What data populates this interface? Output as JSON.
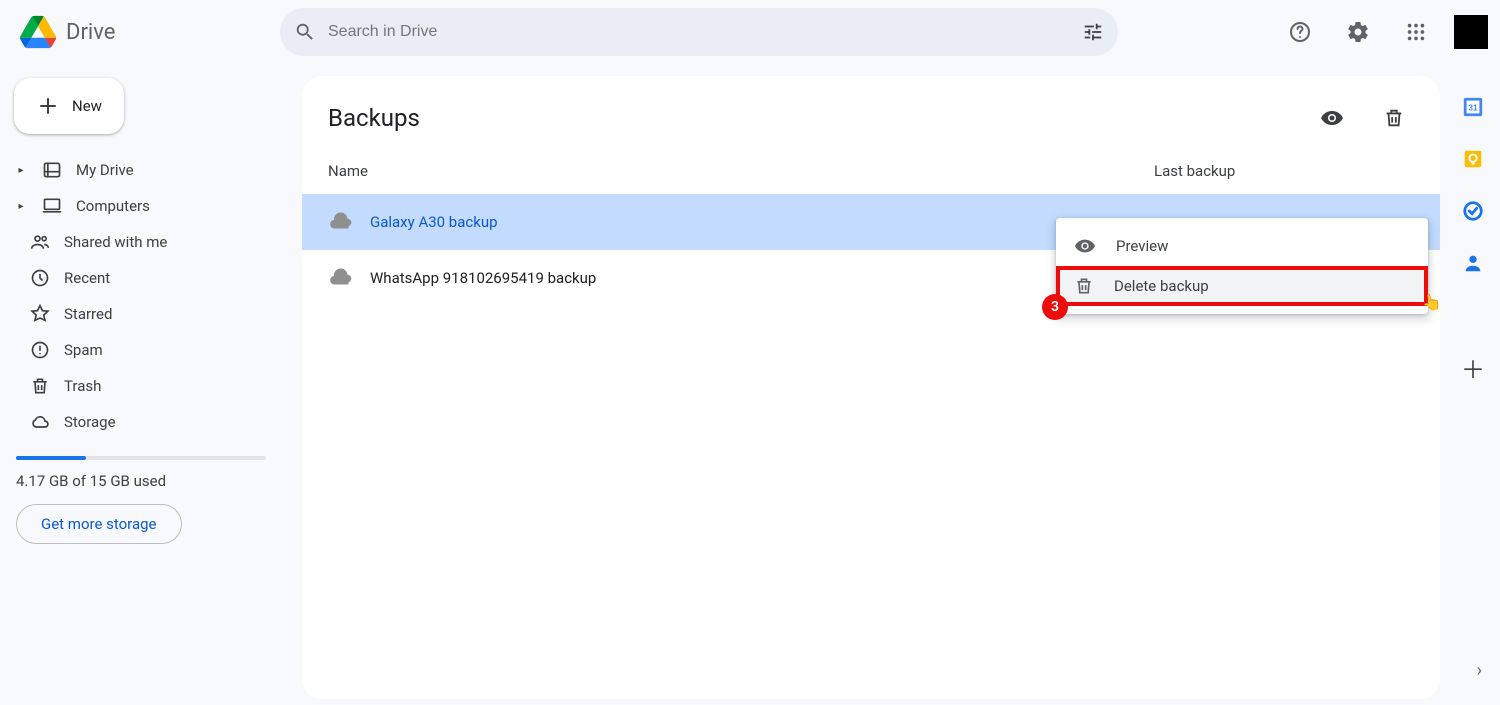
{
  "app": {
    "title": "Drive"
  },
  "search": {
    "placeholder": "Search in Drive"
  },
  "sidebar": {
    "new_label": "New",
    "items": [
      {
        "label": "My Drive"
      },
      {
        "label": "Computers"
      },
      {
        "label": "Shared with me"
      },
      {
        "label": "Recent"
      },
      {
        "label": "Starred"
      },
      {
        "label": "Spam"
      },
      {
        "label": "Trash"
      },
      {
        "label": "Storage"
      }
    ],
    "storage_text": "4.17 GB of 15 GB used",
    "more_storage": "Get more storage"
  },
  "main": {
    "title": "Backups",
    "col_name": "Name",
    "col_last": "Last backup",
    "rows": [
      {
        "name": "Galaxy A30 backup"
      },
      {
        "name": "WhatsApp 918102695419 backup"
      }
    ]
  },
  "context_menu": {
    "preview": "Preview",
    "delete": "Delete backup",
    "badge": "3"
  }
}
